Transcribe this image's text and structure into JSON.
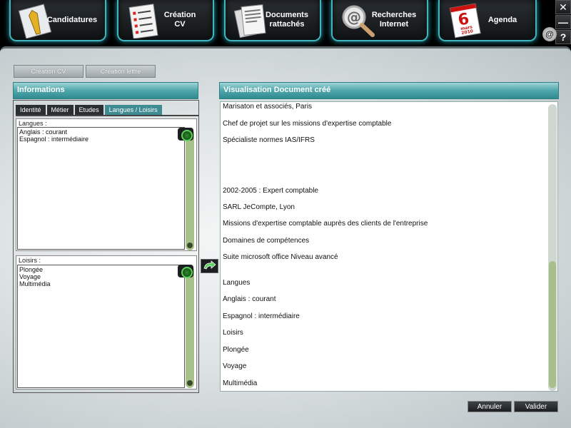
{
  "nav": {
    "items": [
      {
        "label1": "Candidatures",
        "label2": ""
      },
      {
        "label1": "Création",
        "label2": "CV"
      },
      {
        "label1": "Documents",
        "label2": "rattachés"
      },
      {
        "label1": "Recherches",
        "label2": "Internet"
      },
      {
        "label1": "Agenda",
        "label2": ""
      }
    ],
    "calendar_day": "6",
    "calendar_month": "mars",
    "calendar_year": "2010"
  },
  "window": {
    "close_symbol": "✕",
    "minimize_symbol": "—",
    "help_symbol": "?",
    "mail_symbol": "@"
  },
  "toolbar": {
    "creation_cv": "Création CV",
    "creation_lettre": "Création lettre"
  },
  "left": {
    "header": "Informations",
    "tabs": [
      "Identité",
      "Métier",
      "Etudes",
      "Langues / Loisirs"
    ],
    "langues_label": "Langues :",
    "langues_lines": [
      "Anglais : courant",
      "Espagnol : intermédiaire"
    ],
    "loisirs_label": "Loisirs :",
    "loisirs_lines": [
      "Plongée",
      "Voyage",
      "Multimédia"
    ]
  },
  "right": {
    "header": "Visualisation Document créé",
    "lines": [
      "Marisaton et associés, Paris",
      "Chef de projet sur les missions d'expertise comptable",
      "Spécialiste normes IAS/IFRS",
      "2002-2005 : Expert comptable",
      "SARL JeCompte, Lyon",
      "Missions d'expertise comptable auprès des clients de l'entreprise",
      "Domaines de compétences",
      "Suite microsoft office Niveau avancé",
      "Langues",
      "Anglais : courant",
      "Espagnol : intermédiaire",
      "Loisirs",
      "Plongée",
      "Voyage",
      "Multimédia"
    ]
  },
  "actions": {
    "cancel": "Annuler",
    "validate": "Valider"
  },
  "colors": {
    "accent_teal": "#3fb6bf",
    "header_teal": "#4fa6ab",
    "scroll_green": "#a7bf8a",
    "icon_green": "#5fd15f"
  }
}
